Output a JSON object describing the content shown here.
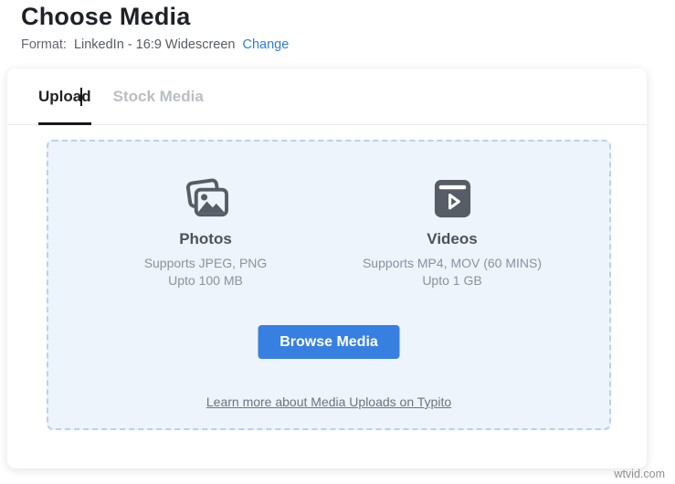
{
  "page": {
    "title": "Choose Media"
  },
  "format": {
    "label": "Format:",
    "value": "LinkedIn - 16:9 Widescreen",
    "change_label": "Change"
  },
  "tabs": [
    {
      "label": "Upload",
      "active": true
    },
    {
      "label": "Stock Media",
      "active": false
    }
  ],
  "dropzone": {
    "photos": {
      "icon": "photos-stack-icon",
      "title": "Photos",
      "line1": "Supports JPEG, PNG",
      "line2": "Upto 100 MB"
    },
    "videos": {
      "icon": "video-player-icon",
      "title": "Videos",
      "line1": "Supports MP4, MOV (60 MINS)",
      "line2": "Upto 1 GB"
    },
    "browse_button_label": "Browse Media",
    "learn_more_label": "Learn more about Media Uploads on Typito"
  },
  "watermark": "wtvid.com",
  "colors": {
    "accent_blue": "#3780e2",
    "link_blue": "#2e7edb",
    "dropzone_background": "#edf4fb",
    "dropzone_border": "#b7d2ee",
    "icon_gray": "#565d66",
    "active_tab": "#17191b",
    "inactive_tab": "#b9bec4"
  }
}
